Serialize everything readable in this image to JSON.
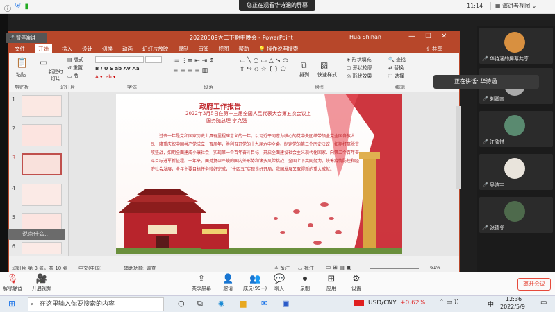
{
  "meeting": {
    "share_banner": "您正在观看华诗涵的屏幕",
    "clock": "11:14",
    "view_mode": "演讲者视图",
    "stop_share": "暂停演讲"
  },
  "ppt": {
    "title": "20220509大二下期中晚会 - PowerPoint",
    "user": "Hua Shihan",
    "share_btn": "共享",
    "tell_me": "操作说明搜索",
    "menus": [
      "文件",
      "开始",
      "插入",
      "设计",
      "切换",
      "动画",
      "幻灯片放映",
      "录制",
      "审阅",
      "视图",
      "帮助"
    ],
    "active_menu": "开始",
    "ribbon": {
      "paste": "粘贴",
      "clipboard": "剪贴板",
      "new_slide": "新建幻灯片",
      "slides": "幻灯片",
      "layout": "版式",
      "reset": "重置",
      "section": "节",
      "font": "字体",
      "paragraph": "段落",
      "drawing": "绘图",
      "arrange": "排列",
      "quick_styles": "快速样式",
      "shape_fill": "形状填充",
      "shape_outline": "形状轮廓",
      "shape_effects": "形状效果",
      "find": "查找",
      "replace": "替换",
      "select": "选择",
      "editing": "编辑"
    },
    "thumb_numbers": [
      "1",
      "2",
      "3",
      "4",
      "5",
      "6"
    ],
    "slide": {
      "title": "政府工作报告",
      "subtitle": "——2022年3月5日在第十三届全国人民代表大会第五次会议上",
      "speaker": "国务院总理  李克强",
      "body": "过去一年是党和国家历史上具有里程碑意义的一年。以习近平同志为核心的党中央团结带领全党全国各族人民，隆重庆祝中国共产党成立一百周年，胜利召开党的十九届六中全会、制定党的第三个历史决议，如期打赢脱贫攻坚战，如期全面建成小康社会，实现第一个百年奋斗目标，开启全面建设社会主义现代化国家、向第二个百年奋斗目标进军新征程。一年来，面对复杂严峻的国内外形势和诸多风险挑战，全国上下共同努力，统筹疫情防控和经济社会发展，全年主要目标任务较好完成，“十四五”实现良好开局，我国发展又取得新的重大成就。"
    },
    "status": {
      "slide_info": "幻灯片 第 3 张，共 10 张",
      "lang": "中文(中国)",
      "accessibility": "辅助功能: 调查",
      "notes": "备注",
      "comments": "批注",
      "zoom": "61%"
    }
  },
  "toast": "正在讲话: 华诗涵",
  "say_something": "说点什么...",
  "participants": [
    {
      "name": "华诗涵的屏幕共享"
    },
    {
      "name": "刘卿南"
    },
    {
      "name": "江欣悦"
    },
    {
      "name": "吴浩宇"
    },
    {
      "name": "张德邻"
    }
  ],
  "bottom_bar": {
    "mute": "解除静音",
    "video": "开启视频",
    "share": "共享屏幕",
    "invite": "邀请",
    "members": "成员(99+)",
    "chat": "聊天",
    "record": "录制",
    "apps": "应用",
    "settings": "设置",
    "leave": "离开会议"
  },
  "taskbar": {
    "search_placeholder": "在这里输入你要搜索的内容",
    "ticker": "USD/CNY",
    "ticker_change": "+0.62%",
    "ime": "中",
    "time": "12:36",
    "date": "2022/5/9"
  },
  "colors": {
    "ppt_accent": "#b7472a",
    "slide_red": "#c0282d",
    "leave_red": "#e64a3b",
    "ticker_red": "#e03030"
  }
}
